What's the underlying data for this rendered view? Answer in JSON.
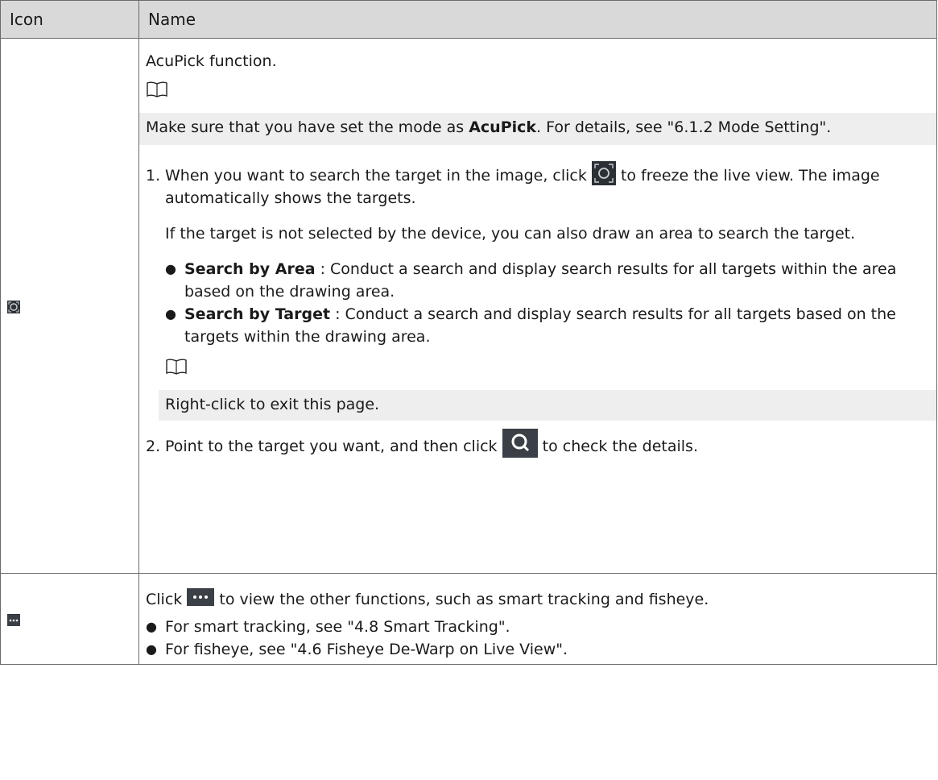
{
  "table": {
    "headers": [
      "Icon",
      "Name"
    ],
    "row1": {
      "icon": "acupick-icon",
      "intro": "AcuPick function.",
      "note1_prefix": "Make sure that you have set the mode as ",
      "note1_bold": "AcuPick",
      "note1_suffix": ". For details, see \"6.1.2 Mode Setting\".",
      "step1_num": "1.",
      "step1_before": "When you want to search the target in the image, click ",
      "step1_after": " to freeze the live view. The image automatically shows the targets.",
      "step1_extra": "If the target is not selected by the device, you can also draw an area to search the target.",
      "bullet1_bold": "Search by Area",
      "bullet1_text": " : Conduct a search and display search results for all targets within the area based on the drawing area.",
      "bullet2_bold": "Search by Target",
      "bullet2_text": " : Conduct a search and display search results for all targets based on the targets within the drawing area.",
      "note2": "Right-click to exit this page.",
      "step2_num": "2.",
      "step2_before": "Point to the target you want, and then click ",
      "step2_after": " to check the details."
    },
    "row2": {
      "icon": "more-icon",
      "click_before": "Click ",
      "click_after": " to view the other functions, such as smart tracking and fisheye.",
      "bullet1": "For smart tracking, see \"4.8 Smart Tracking\".",
      "bullet2": "For fisheye, see \"4.6 Fisheye De-Warp on Live View\"."
    }
  },
  "bullet_glyph": "●"
}
